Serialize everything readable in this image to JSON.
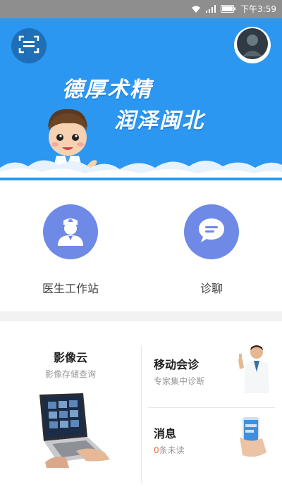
{
  "status_bar": {
    "time": "下午3:59"
  },
  "banner": {
    "slogan_line1": "德厚术精",
    "slogan_line2": "润泽闽北",
    "colors": {
      "background": "#2b97f0"
    }
  },
  "quick_entries": [
    {
      "label": "医生工作站",
      "icon": "doctor-icon"
    },
    {
      "label": "诊聊",
      "icon": "chat-bubble-icon"
    }
  ],
  "cards": {
    "imaging": {
      "title": "影像云",
      "subtitle": "影像存储查询"
    },
    "consultation": {
      "title": "移动会诊",
      "subtitle": "专家集中诊断"
    },
    "messages": {
      "title": "消息",
      "count": "0",
      "count_suffix": "条未读"
    }
  },
  "colors": {
    "accent": "#6e89e6",
    "unread": "#f26b3a"
  }
}
